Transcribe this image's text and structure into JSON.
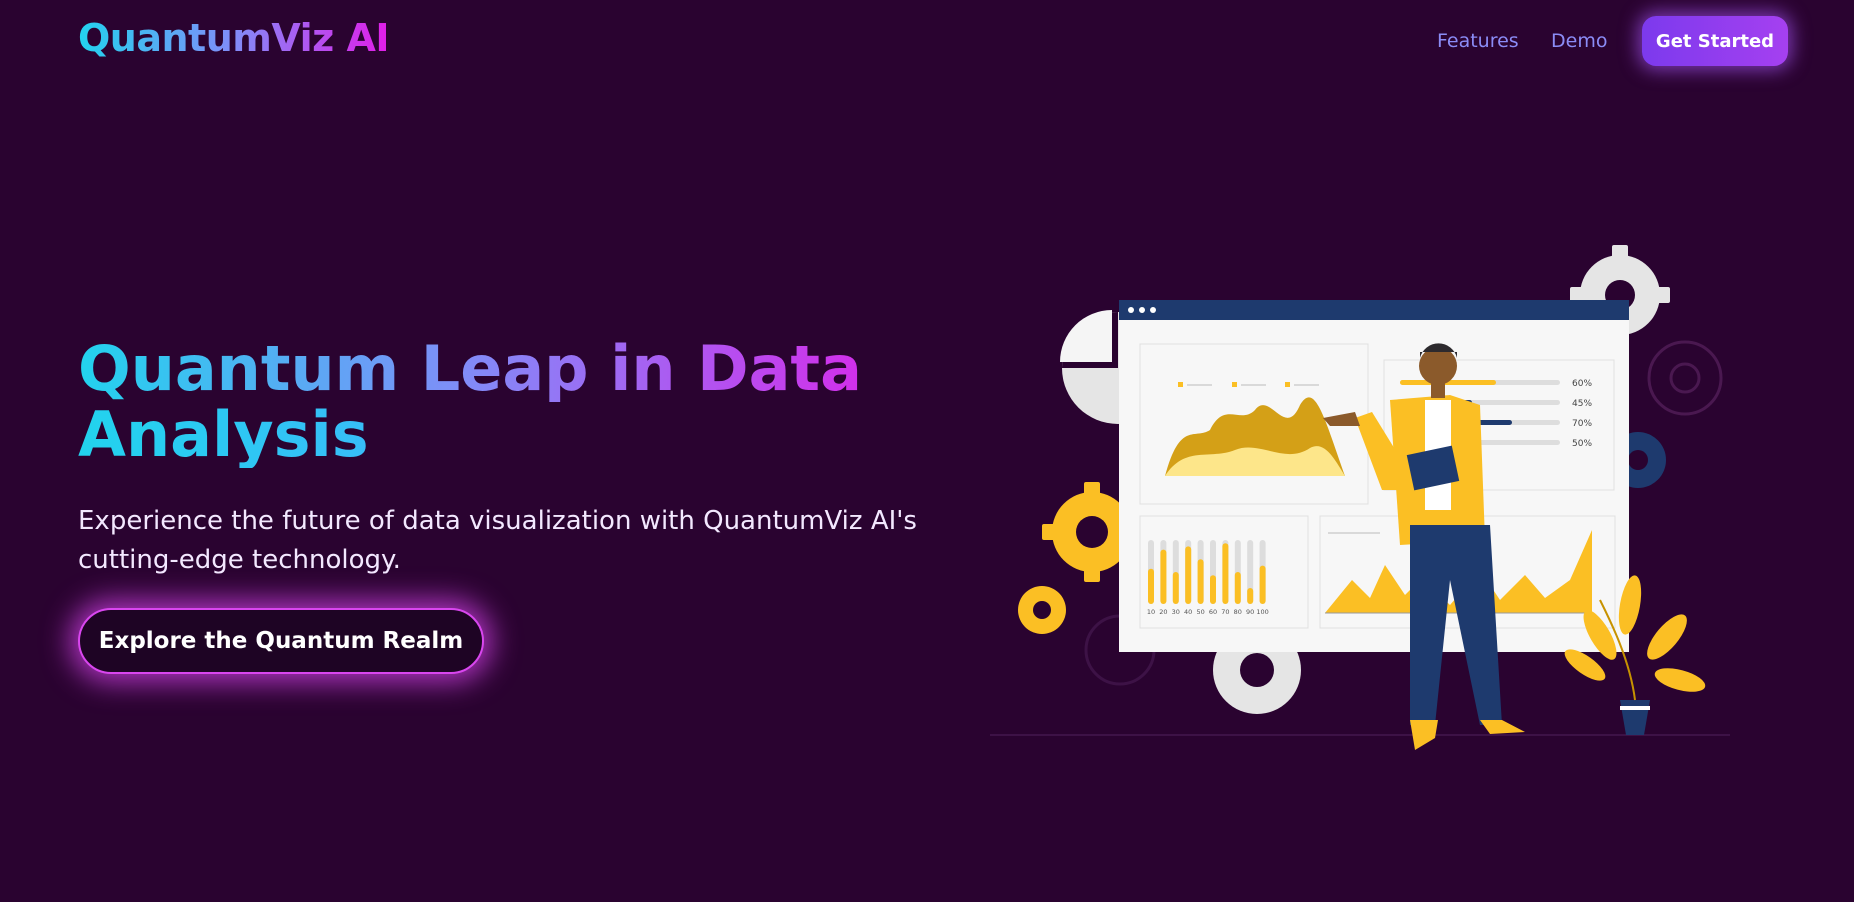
{
  "brand": {
    "name": "QuantumViz AI"
  },
  "nav": {
    "links": [
      "Features",
      "Demo"
    ],
    "cta": "Get Started"
  },
  "hero": {
    "title_line1": "Quantum Leap in Data",
    "title_line2": "Analysis",
    "subtitle": "Experience the future of data visualization with QuantumViz AI's cutting-edge technology.",
    "cta": "Explore the Quantum Realm"
  },
  "illustration": {
    "bars_ticks": [
      "10",
      "20",
      "30",
      "40",
      "50",
      "60",
      "70",
      "80",
      "90",
      "100"
    ],
    "progress": [
      {
        "label": "60%",
        "value": 0.6
      },
      {
        "label": "45%",
        "value": 0.45
      },
      {
        "label": "70%",
        "value": 0.7
      },
      {
        "label": "50%",
        "value": 0.5
      }
    ],
    "icons": [
      "gear-icon",
      "pie-chart-icon",
      "plant-icon",
      "presenter-figure"
    ]
  },
  "colors": {
    "background": "#2a0330",
    "accent_cyan": "#22d3ee",
    "accent_violet": "#818cf8",
    "accent_magenta": "#e11de8",
    "cta_purple": "#7c3aed",
    "chart_yellow": "#fbbf24",
    "chart_navy": "#1e3a6e"
  }
}
